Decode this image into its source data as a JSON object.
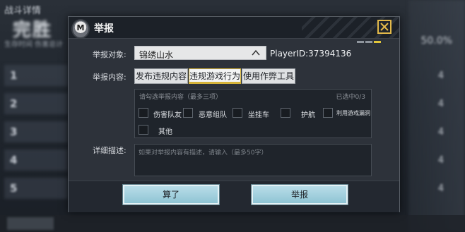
{
  "background": {
    "title": "战斗详情",
    "big_text": "完胜",
    "subtitle": "生存时间 伤害总计",
    "ranks": [
      "1",
      "2",
      "3",
      "4",
      "5"
    ],
    "right_percent": "50.0%",
    "right_numbers": [
      "4",
      "4",
      "4",
      "4",
      "4"
    ]
  },
  "dialog": {
    "title": "举报",
    "target_label": "举报对象:",
    "target_value": "锦绣山水",
    "player_id": "PlayerID:37394136",
    "content_label": "举报内容:",
    "tabs": [
      "发布违规内容",
      "违规游戏行为",
      "使用作弊工具"
    ],
    "active_tab": 1,
    "options_hint": "请勾选举报内容（最多三项）",
    "options_count": "已选中0/3",
    "options": [
      "伤害队友",
      "恶意组队",
      "坐挂车",
      "护航",
      "利用游戏漏洞",
      "其他"
    ],
    "desc_label": "详细描述:",
    "desc_placeholder": "如果对举报内容有描述，请输入（最多50字）",
    "cancel_label": "算了",
    "submit_label": "举报"
  },
  "colors": {
    "accent": "#e2c63a",
    "button": "#9fd0de",
    "dialog_bg": "#2d323a"
  }
}
